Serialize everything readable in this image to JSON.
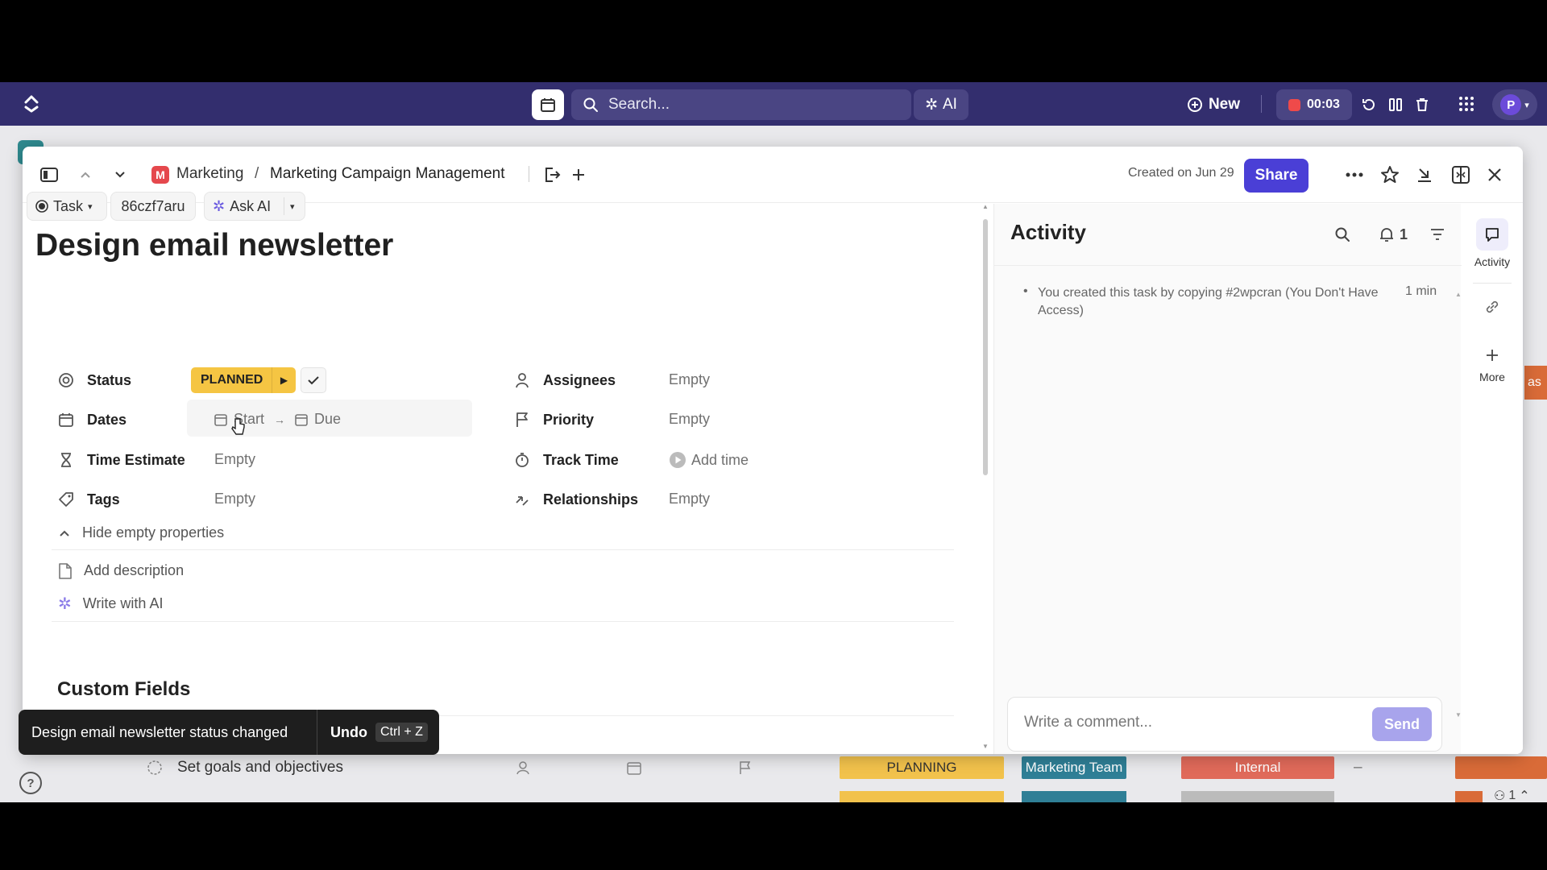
{
  "topbar": {
    "search_placeholder": "Search...",
    "ai_label": "AI",
    "new_label": "New",
    "timer": "00:03",
    "avatar_initial": "P"
  },
  "modal": {
    "breadcrumb": {
      "workspace_initial": "M",
      "space": "Marketing",
      "separator": "/",
      "list": "Marketing Campaign Management"
    },
    "created": "Created on Jun 29",
    "share_label": "Share"
  },
  "task": {
    "type_label": "Task",
    "id": "86czf7aru",
    "ask_ai_label": "Ask AI",
    "title": "Design email newsletter"
  },
  "properties": {
    "status": {
      "label": "Status",
      "value": "PLANNED",
      "color": "#f5c543"
    },
    "dates": {
      "label": "Dates",
      "start": "Start",
      "due": "Due"
    },
    "time_estimate": {
      "label": "Time Estimate",
      "value": "Empty"
    },
    "tags": {
      "label": "Tags",
      "value": "Empty"
    },
    "assignees": {
      "label": "Assignees",
      "value": "Empty"
    },
    "priority": {
      "label": "Priority",
      "value": "Empty"
    },
    "track_time": {
      "label": "Track Time",
      "value": "Add time"
    },
    "relationships": {
      "label": "Relationships",
      "value": "Empty"
    }
  },
  "hide_empty_label": "Hide empty properties",
  "description": {
    "add_label": "Add description",
    "write_ai_label": "Write with AI"
  },
  "custom_fields_title": "Custom Fields",
  "activity": {
    "title": "Activity",
    "notif_count": "1",
    "entry_text": "You created this task by copying #2wpcran (You Don't Have Access)",
    "entry_time": "1 min",
    "comment_placeholder": "Write a comment...",
    "send_label": "Send"
  },
  "rail": {
    "activity_label": "Activity",
    "more_label": "More"
  },
  "toast": {
    "message": "Design email newsletter status changed",
    "undo_label": "Undo",
    "shortcut": "Ctrl + Z"
  },
  "background": {
    "row_title": "Set goals and objectives",
    "row_status": "PLANNING",
    "row_team": "Marketing Team",
    "row_type": "Internal",
    "row_dash": "–",
    "side_tab_text": "as",
    "bottom_count": "1",
    "help_label": "?"
  },
  "colors": {
    "topbar": "#332e6e",
    "accent": "#4a3fd6",
    "status_planned": "#f5c543",
    "planning_pill": "#f2c24c",
    "team_pill": "#2f7f96",
    "internal_pill": "#e06a5a"
  }
}
